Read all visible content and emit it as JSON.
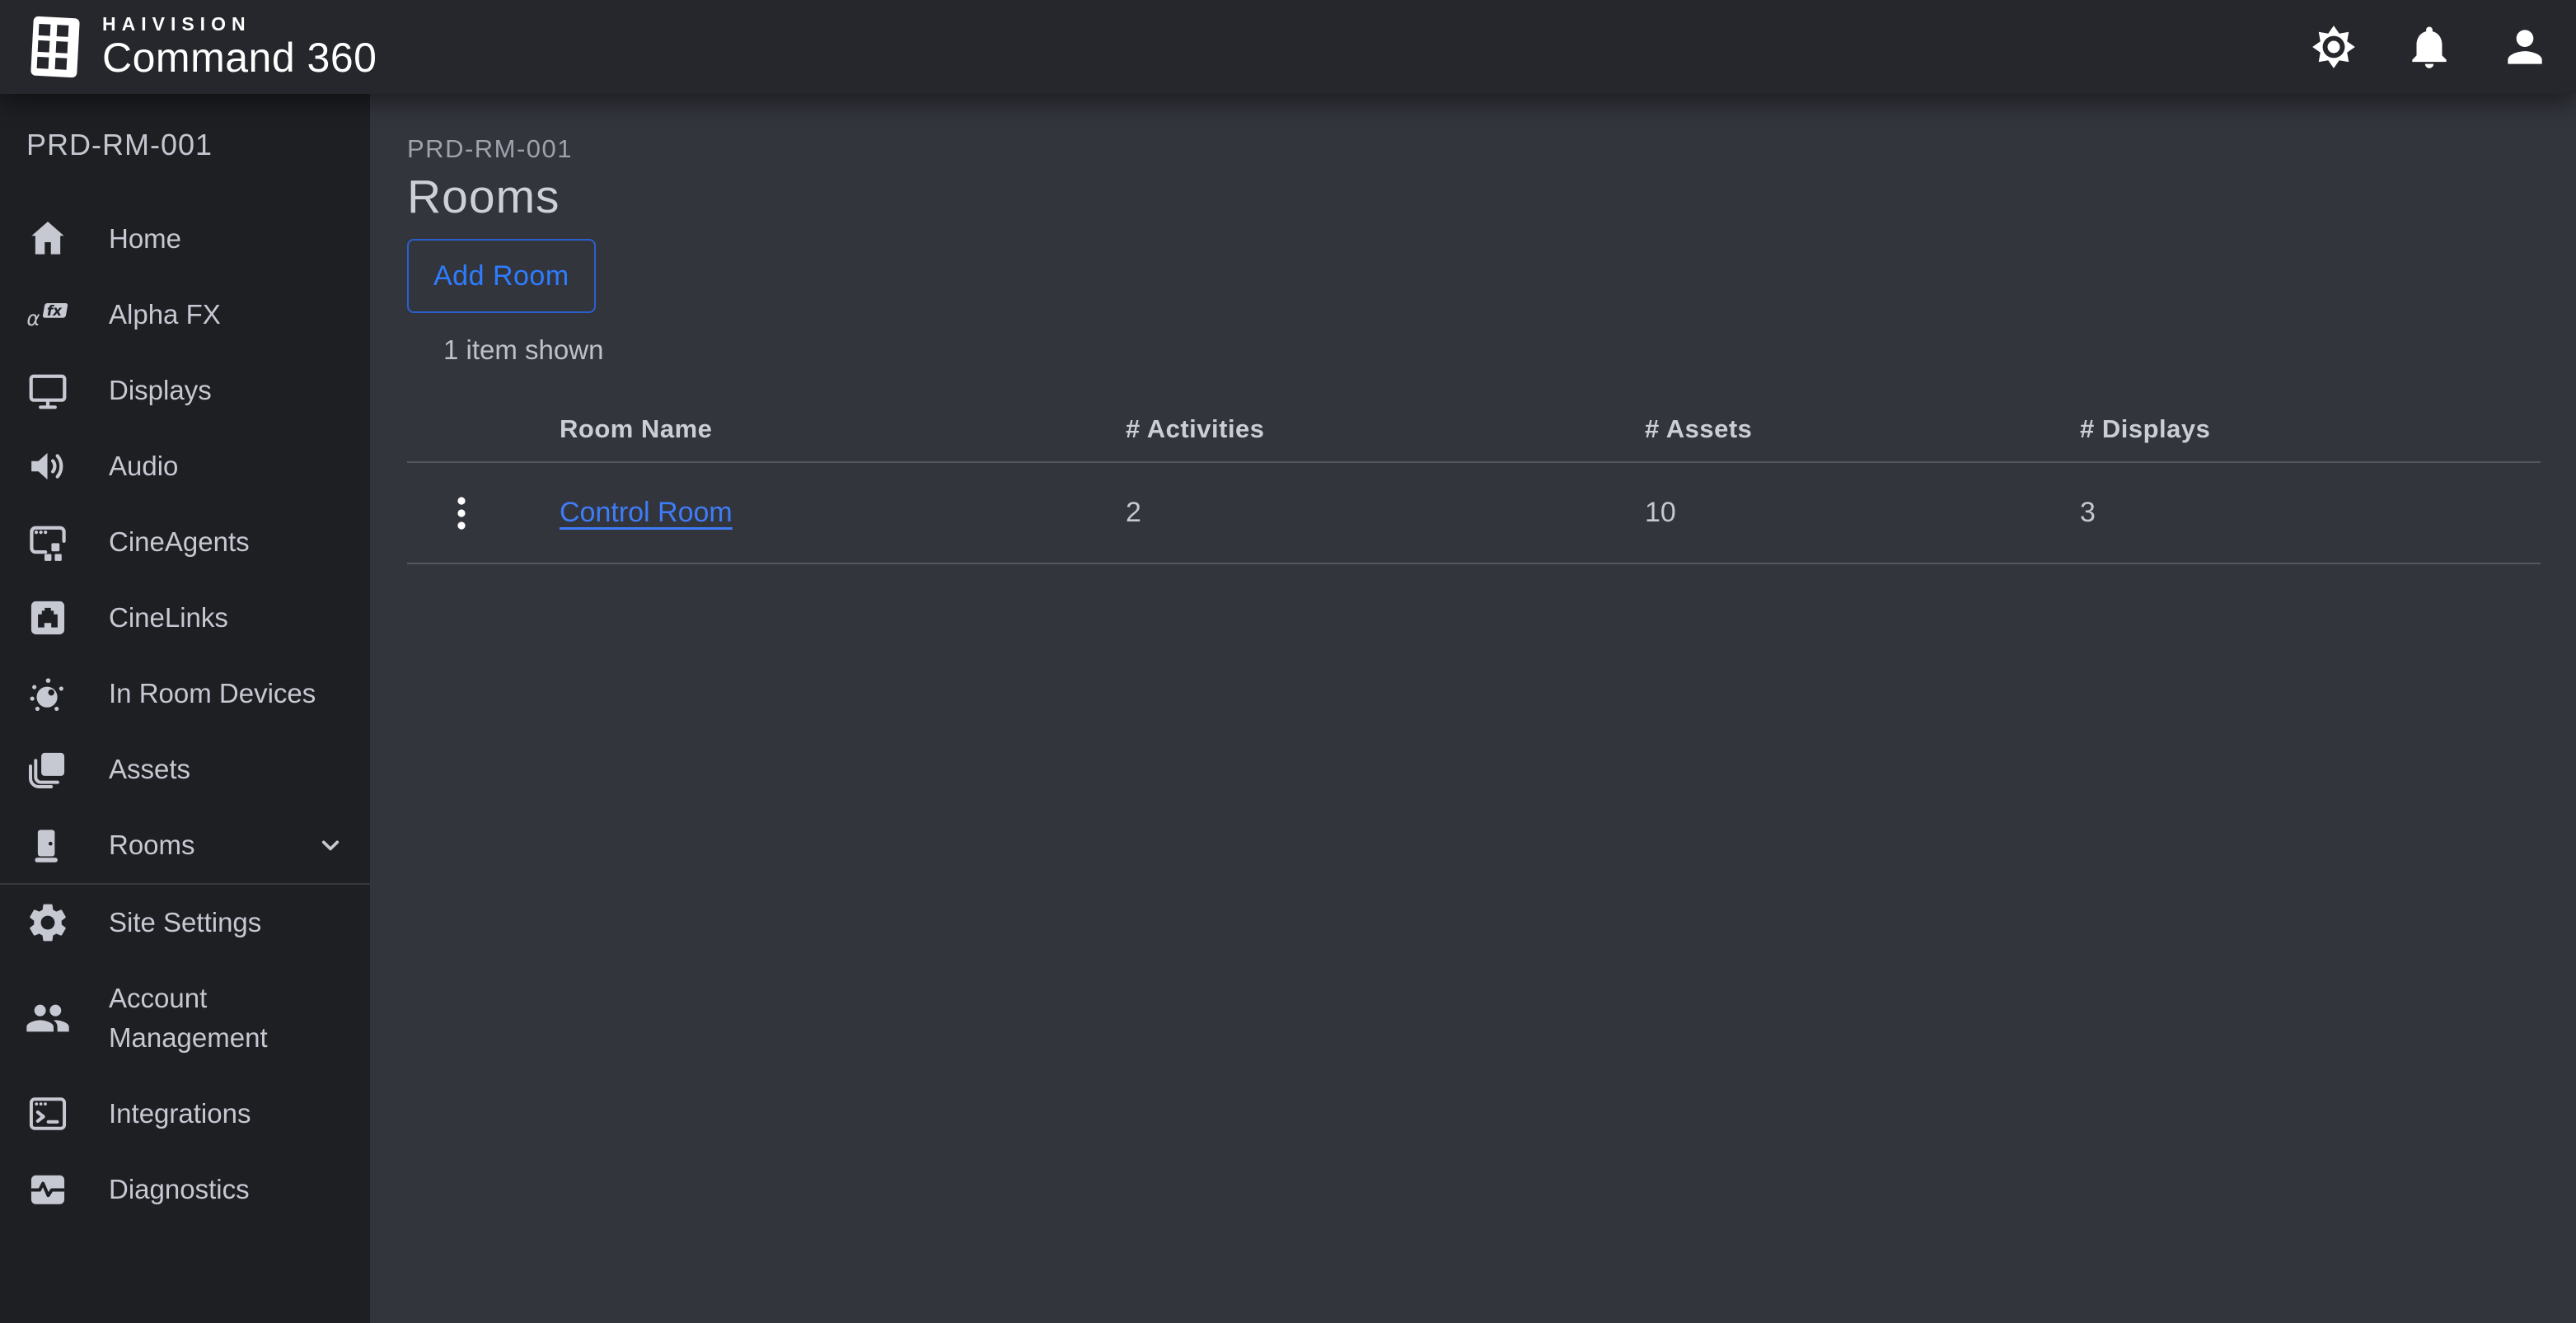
{
  "topbar": {
    "brand": "HAIVISION",
    "product": "Command 360",
    "actions": [
      {
        "name": "settings",
        "icon": "gear-icon"
      },
      {
        "name": "notifications",
        "icon": "bell-icon"
      },
      {
        "name": "profile",
        "icon": "person-icon"
      }
    ]
  },
  "sidebar": {
    "site_label": "PRD-RM-001",
    "items": [
      {
        "label": "Home",
        "icon": "home-icon"
      },
      {
        "label": "Alpha FX",
        "icon": "alpha-fx-icon"
      },
      {
        "label": "Displays",
        "icon": "display-icon"
      },
      {
        "label": "Audio",
        "icon": "speaker-icon"
      },
      {
        "label": "CineAgents",
        "icon": "cineagents-window-icon"
      },
      {
        "label": "CineLinks",
        "icon": "ethernet-port-icon"
      },
      {
        "label": "In Room Devices",
        "icon": "device-hub-icon"
      },
      {
        "label": "Assets",
        "icon": "stacked-assets-icon"
      },
      {
        "label": "Rooms",
        "icon": "door-icon",
        "expanded_indicator": "chevron-down-icon"
      }
    ],
    "secondary_items": [
      {
        "label": "Site Settings",
        "icon": "gear-icon"
      },
      {
        "label": "Account Management",
        "icon": "people-icon"
      },
      {
        "label": "Integrations",
        "icon": "terminal-window-icon"
      },
      {
        "label": "Diagnostics",
        "icon": "pulse-icon"
      }
    ]
  },
  "main": {
    "breadcrumb": "PRD-RM-001",
    "title": "Rooms",
    "add_room_label": "Add Room",
    "items_shown": "1 item shown",
    "table": {
      "columns": [
        "Room Name",
        "# Activities",
        "# Assets",
        "# Displays"
      ],
      "rows": [
        {
          "room_name": "Control Room",
          "activities": "2",
          "assets": "10",
          "displays": "3"
        }
      ]
    }
  },
  "colors": {
    "topbar_bg": "#26272c",
    "sidebar_bg": "#1e1f23",
    "main_bg": "#33353d",
    "accent_blue": "#2e7cff",
    "link_blue": "#3f7cf6"
  }
}
